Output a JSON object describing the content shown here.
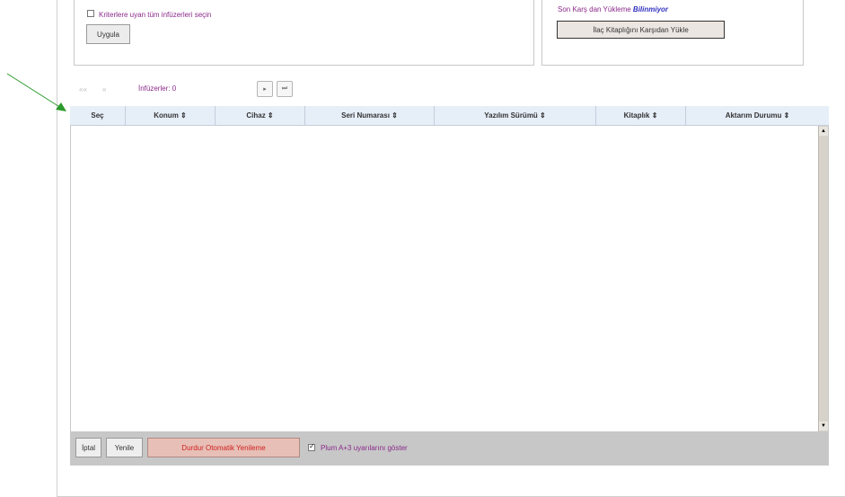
{
  "filters": {
    "select_all_label": "Kriterlere uyan tüm infüzerleri seçin",
    "select_all_checked": false,
    "apply_label": "Uygula"
  },
  "library": {
    "last_load_label": "Son Karş dan Yükleme",
    "last_load_value": "Bilinmiyor",
    "load_button_label": "İlaç Kitaplığını Karşıdan Yükle"
  },
  "pager": {
    "first": "««",
    "prev": "«",
    "count_label": "İnfüzerler: 0",
    "next": "▸",
    "last": "⏭"
  },
  "table": {
    "columns": [
      {
        "label": "Seç"
      },
      {
        "label": "Konum ⇕"
      },
      {
        "label": "Cihaz ⇕"
      },
      {
        "label": "Seri Numarası ⇕"
      },
      {
        "label": "Yazılım Sürümü ⇕"
      },
      {
        "label": "Kitaplık ⇕"
      },
      {
        "label": "Aktarım Durumu ⇕"
      }
    ],
    "rows": []
  },
  "footer": {
    "cancel_label": "İptal",
    "refresh_label": "Yenile",
    "stop_auto_refresh_label": "Durdur Otomatik Yenileme",
    "show_alerts_label": "Plum A+3 uyarılarını göster",
    "show_alerts_checked": true
  },
  "colors": {
    "header_bg": "#e6eef8",
    "footer_bg": "#c7c7c7",
    "accent_purple": "#8a2a8a",
    "annotation_arrow": "#2a9a2a"
  },
  "icons": {
    "annotation": "arrow-pointer-icon",
    "scroll_up": "scroll-up-icon",
    "scroll_down": "scroll-down-icon"
  }
}
